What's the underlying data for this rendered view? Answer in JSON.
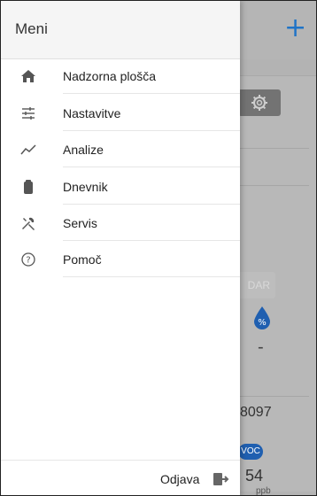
{
  "drawer": {
    "title": "Meni",
    "items": [
      {
        "label": "Nadzorna plošča",
        "icon": "home-icon"
      },
      {
        "label": "Nastavitve",
        "icon": "sliders-icon"
      },
      {
        "label": "Analize",
        "icon": "trend-icon"
      },
      {
        "label": "Dnevnik",
        "icon": "clipboard-icon"
      },
      {
        "label": "Servis",
        "icon": "tools-icon"
      },
      {
        "label": "Pomoč",
        "icon": "help-icon"
      }
    ],
    "logout_label": "Odjava"
  },
  "background": {
    "add_symbol": "+",
    "button_text": "DAR",
    "placeholder_value": "-",
    "number_value": "8097",
    "voc_badge": "VOC",
    "voc_value": "54",
    "voc_unit": "ppb"
  },
  "colors": {
    "accent": "#1f73c7",
    "drawer_bg": "#ffffff",
    "header_bg": "#f5f5f5",
    "overlay": "#b3b3b3"
  }
}
